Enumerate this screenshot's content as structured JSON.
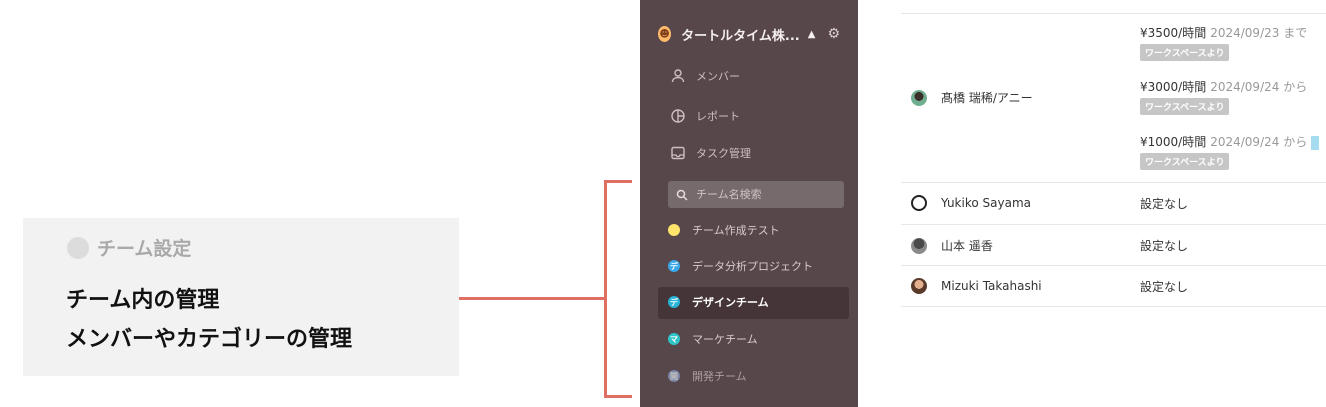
{
  "caption": {
    "tag": "チーム設定",
    "line1": "チーム内の管理",
    "line2": "メンバーやカテゴリーの管理"
  },
  "sidebar": {
    "team_name": "タートルタイム株...",
    "nav": [
      {
        "label": "メンバー",
        "icon": "person-icon"
      },
      {
        "label": "レポート",
        "icon": "pie-chart-icon"
      },
      {
        "label": "タスク管理",
        "icon": "inbox-icon"
      }
    ],
    "search_placeholder": "チーム名検索",
    "teams": [
      {
        "label": "チーム作成テスト",
        "color": "#ffe36b"
      },
      {
        "label": "データ分析プロジェクト",
        "color": "#3aa7e8"
      },
      {
        "label": "デザインチーム",
        "color": "#26b3d6",
        "selected": true
      },
      {
        "label": "マーケチーム",
        "color": "#2ec4c9"
      },
      {
        "label": "開発チーム",
        "color": "#8aa8d6"
      }
    ]
  },
  "table": {
    "rows": [
      {
        "name": "髙橋 瑞稀/アニー",
        "rates": [
          {
            "rate": "¥3500/時間",
            "date": "2024/09/23 まで",
            "source": "ワークスペースより"
          },
          {
            "rate": "¥3000/時間",
            "date": "2024/09/24 から",
            "source": "ワークスペースより"
          },
          {
            "rate": "¥1000/時間",
            "date": "2024/09/24 から",
            "source": "ワークスペースより"
          }
        ]
      },
      {
        "name": "Yukiko Sayama",
        "value": "設定なし"
      },
      {
        "name": "山本 遥香",
        "value": "設定なし"
      },
      {
        "name": "Mizuki Takahashi",
        "value": "設定なし"
      }
    ]
  },
  "colors": {
    "accent": "#e06e63",
    "sidebar_bg": "#57474a"
  }
}
